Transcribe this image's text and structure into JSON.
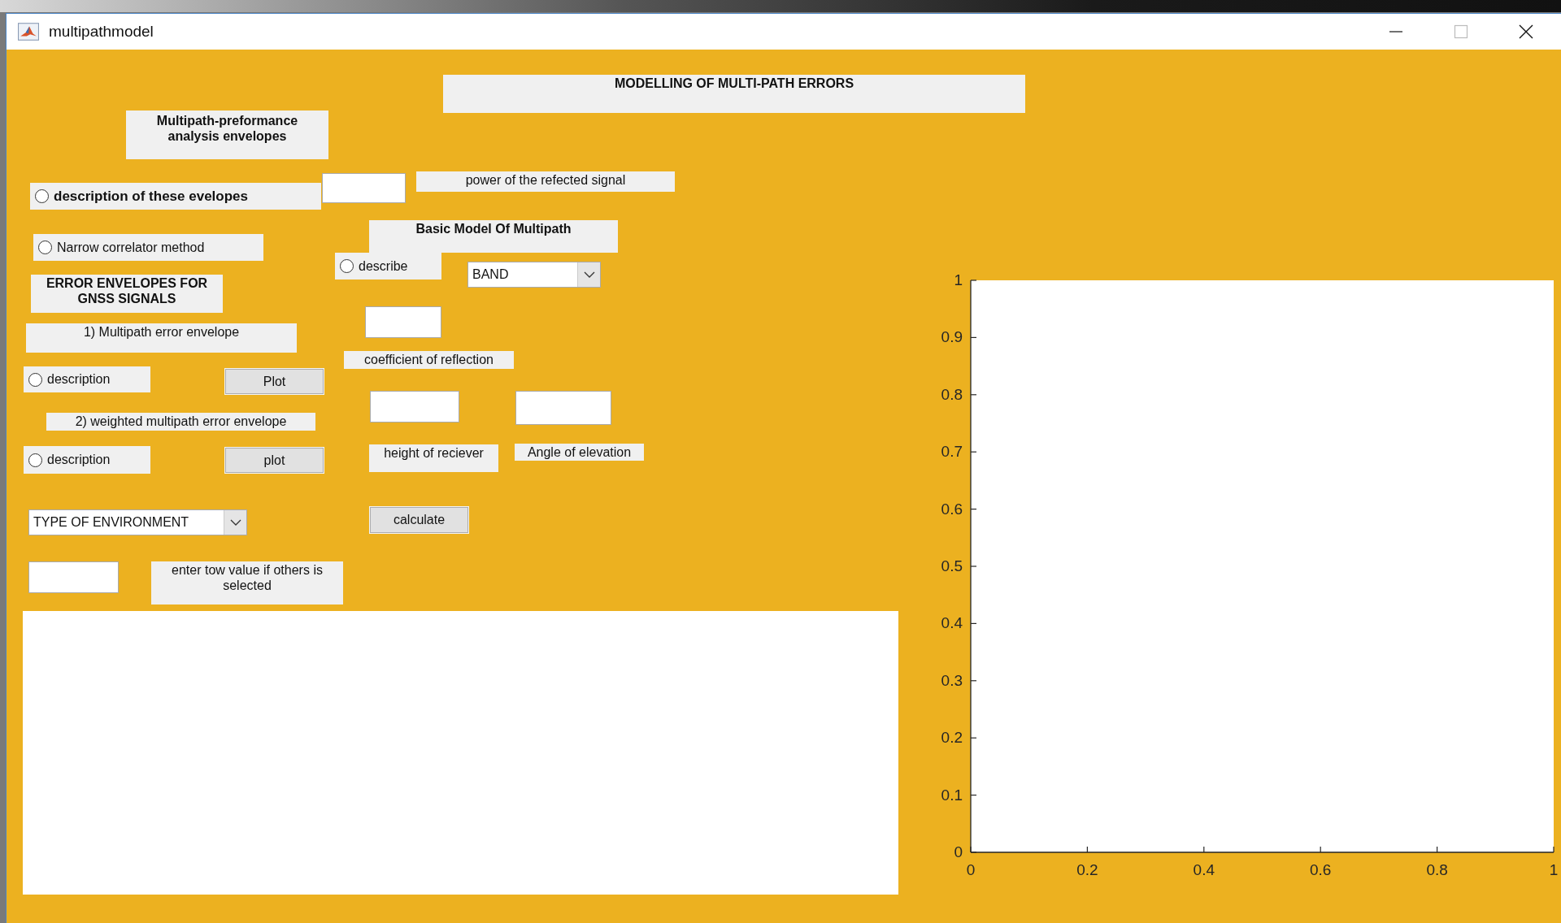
{
  "window": {
    "title": "multipathmodel"
  },
  "controls": [
    {
      "kind": "heading",
      "text": "MODELLING OF MULTI-PATH ERRORS"
    },
    {
      "kind": "heading",
      "text": "Multipath-preformance analysis envelopes"
    },
    {
      "kind": "radio",
      "text": "description of these evelopes",
      "bold": true,
      "selected": false
    },
    {
      "kind": "field"
    },
    {
      "kind": "label",
      "text": "power of the refected signal"
    },
    {
      "kind": "radio",
      "text": "Narrow correlator method",
      "bold": false,
      "selected": false
    },
    {
      "kind": "heading",
      "text": "Basic Model Of Multipath"
    },
    {
      "kind": "radio",
      "text": "describe",
      "bold": false,
      "selected": false
    },
    {
      "kind": "dropdown",
      "value": "BAND"
    },
    {
      "kind": "heading",
      "text": "ERROR ENVELOPES FOR GNSS SIGNALS"
    },
    {
      "kind": "label",
      "text": "1) Multipath error envelope"
    },
    {
      "kind": "field"
    },
    {
      "kind": "label",
      "text": "coefficient of reflection"
    },
    {
      "kind": "radio",
      "text": "description",
      "bold": false,
      "selected": false
    },
    {
      "kind": "button",
      "text": "Plot"
    },
    {
      "kind": "field"
    },
    {
      "kind": "field"
    },
    {
      "kind": "label",
      "text": "2) weighted multipath error envelope"
    },
    {
      "kind": "radio",
      "text": "description",
      "bold": false,
      "selected": false
    },
    {
      "kind": "button",
      "text": "plot"
    },
    {
      "kind": "label",
      "text": "height of reciever"
    },
    {
      "kind": "label",
      "text": "Angle of elevation"
    },
    {
      "kind": "dropdown",
      "value": "TYPE OF ENVIRONMENT"
    },
    {
      "kind": "button",
      "text": "calculate"
    },
    {
      "kind": "field"
    },
    {
      "kind": "label",
      "text": "enter tow value if others is selected"
    },
    {
      "kind": "text-area"
    }
  ],
  "axes": {
    "chart_data": {
      "type": "line",
      "xlim": [
        0,
        1
      ],
      "ylim": [
        0,
        1
      ],
      "xticks": [
        0,
        0.2,
        0.4,
        0.6,
        0.8,
        1
      ],
      "yticks": [
        0,
        0.1,
        0.2,
        0.3,
        0.4,
        0.5,
        0.6,
        0.7,
        0.8,
        0.9,
        1
      ]
    }
  }
}
